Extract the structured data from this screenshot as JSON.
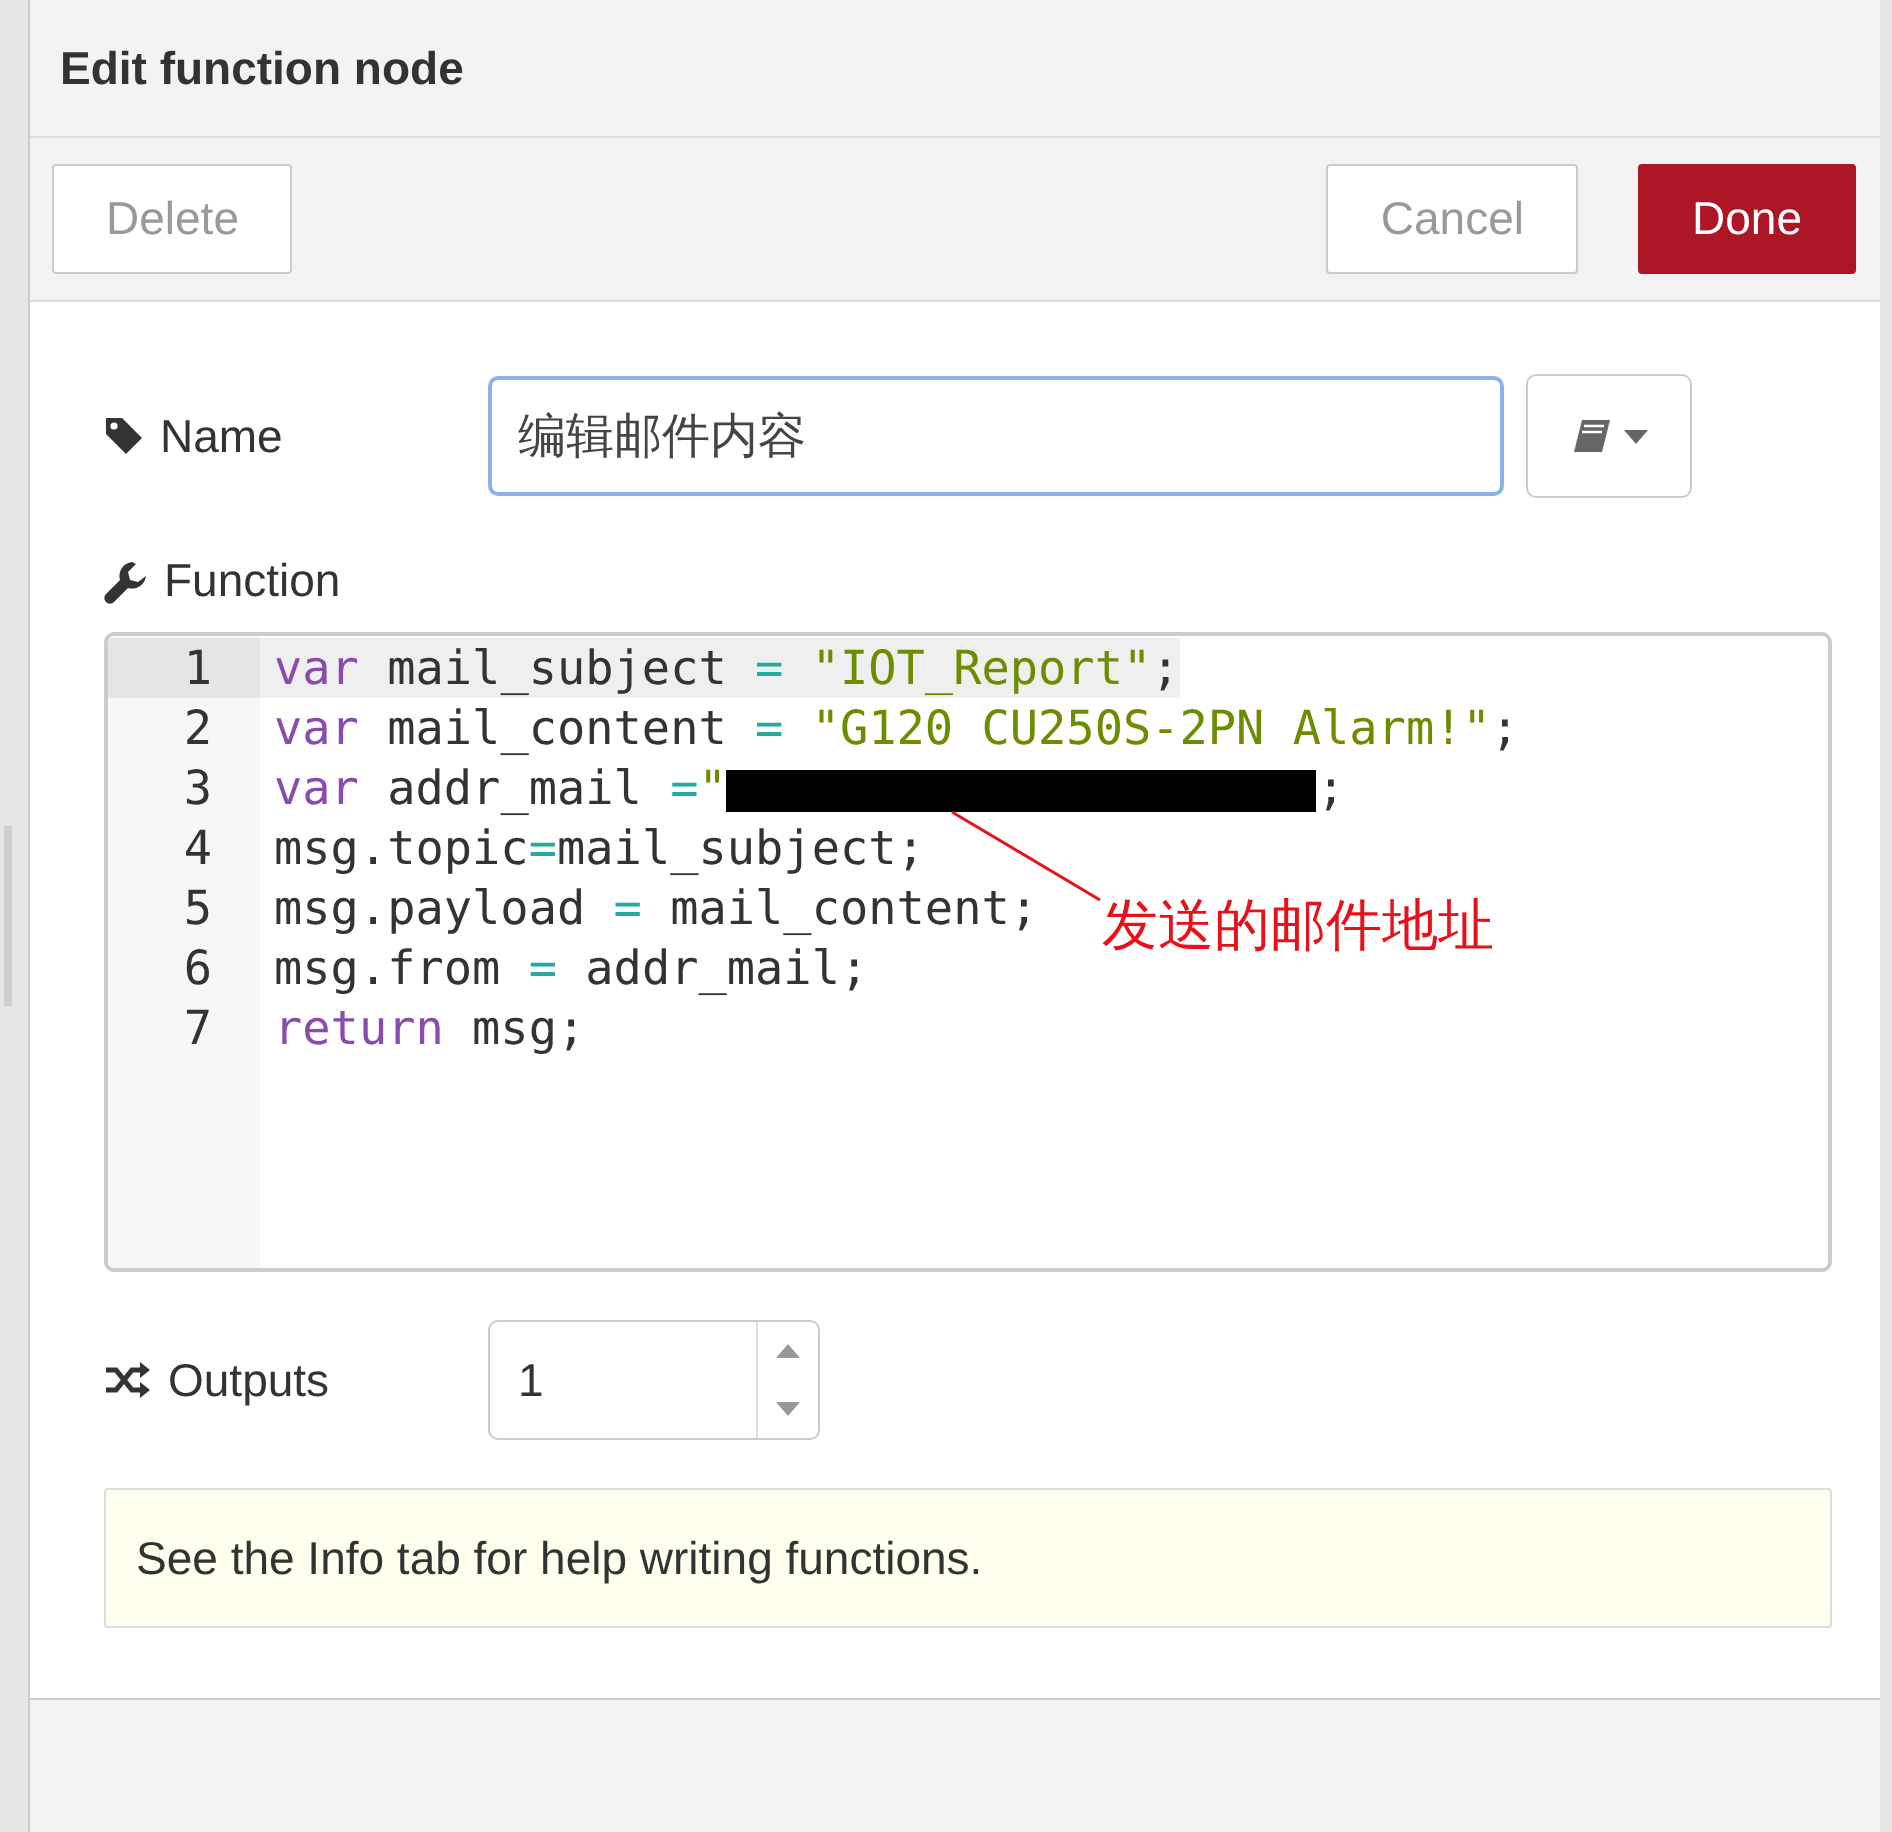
{
  "dialog": {
    "title": "Edit function node"
  },
  "buttons": [
    {
      "label": "Delete",
      "kind": "plain"
    },
    {
      "label": "Cancel",
      "kind": "plain"
    },
    {
      "label": "Done",
      "kind": "primary"
    }
  ],
  "name_field": {
    "label": "Name",
    "value": "编辑邮件内容"
  },
  "function_editor": {
    "label": "Function",
    "lines": [
      {
        "number": "1",
        "active": true,
        "tokens": [
          {
            "kind": "keyword",
            "text": "var"
          },
          {
            "kind": "plain",
            "text": " mail_subject "
          },
          {
            "kind": "operator",
            "text": "="
          },
          {
            "kind": "string",
            "text": " \"IOT_Report\""
          },
          {
            "kind": "plain",
            "text": ";"
          }
        ]
      },
      {
        "number": "2",
        "active": false,
        "tokens": [
          {
            "kind": "keyword",
            "text": "var"
          },
          {
            "kind": "plain",
            "text": " mail_content "
          },
          {
            "kind": "operator",
            "text": "="
          },
          {
            "kind": "string",
            "text": " \"G120 CU250S-2PN Alarm!\""
          },
          {
            "kind": "plain",
            "text": ";"
          }
        ]
      },
      {
        "number": "3",
        "active": false,
        "tokens": [
          {
            "kind": "keyword",
            "text": "var"
          },
          {
            "kind": "plain",
            "text": " addr_mail "
          },
          {
            "kind": "operator",
            "text": "="
          },
          {
            "kind": "string",
            "text": "\""
          },
          {
            "kind": "redacted"
          },
          {
            "kind": "plain",
            "text": ";"
          }
        ]
      },
      {
        "number": "4",
        "active": false,
        "tokens": [
          {
            "kind": "plain",
            "text": "msg.topic"
          },
          {
            "kind": "operator",
            "text": "="
          },
          {
            "kind": "plain",
            "text": "mail_subject;"
          }
        ]
      },
      {
        "number": "5",
        "active": false,
        "tokens": [
          {
            "kind": "plain",
            "text": "msg.payload "
          },
          {
            "kind": "operator",
            "text": "="
          },
          {
            "kind": "plain",
            "text": " mail_content;"
          }
        ]
      },
      {
        "number": "6",
        "active": false,
        "tokens": [
          {
            "kind": "plain",
            "text": "msg.from "
          },
          {
            "kind": "operator",
            "text": "="
          },
          {
            "kind": "plain",
            "text": " addr_mail;"
          }
        ]
      },
      {
        "number": "7",
        "active": false,
        "tokens": [
          {
            "kind": "keyword",
            "text": "return"
          },
          {
            "kind": "plain",
            "text": " msg;"
          }
        ]
      }
    ],
    "annotation": "发送的邮件地址"
  },
  "outputs": {
    "label": "Outputs",
    "value": "1"
  },
  "tip": "See the Info tab for help writing functions."
}
